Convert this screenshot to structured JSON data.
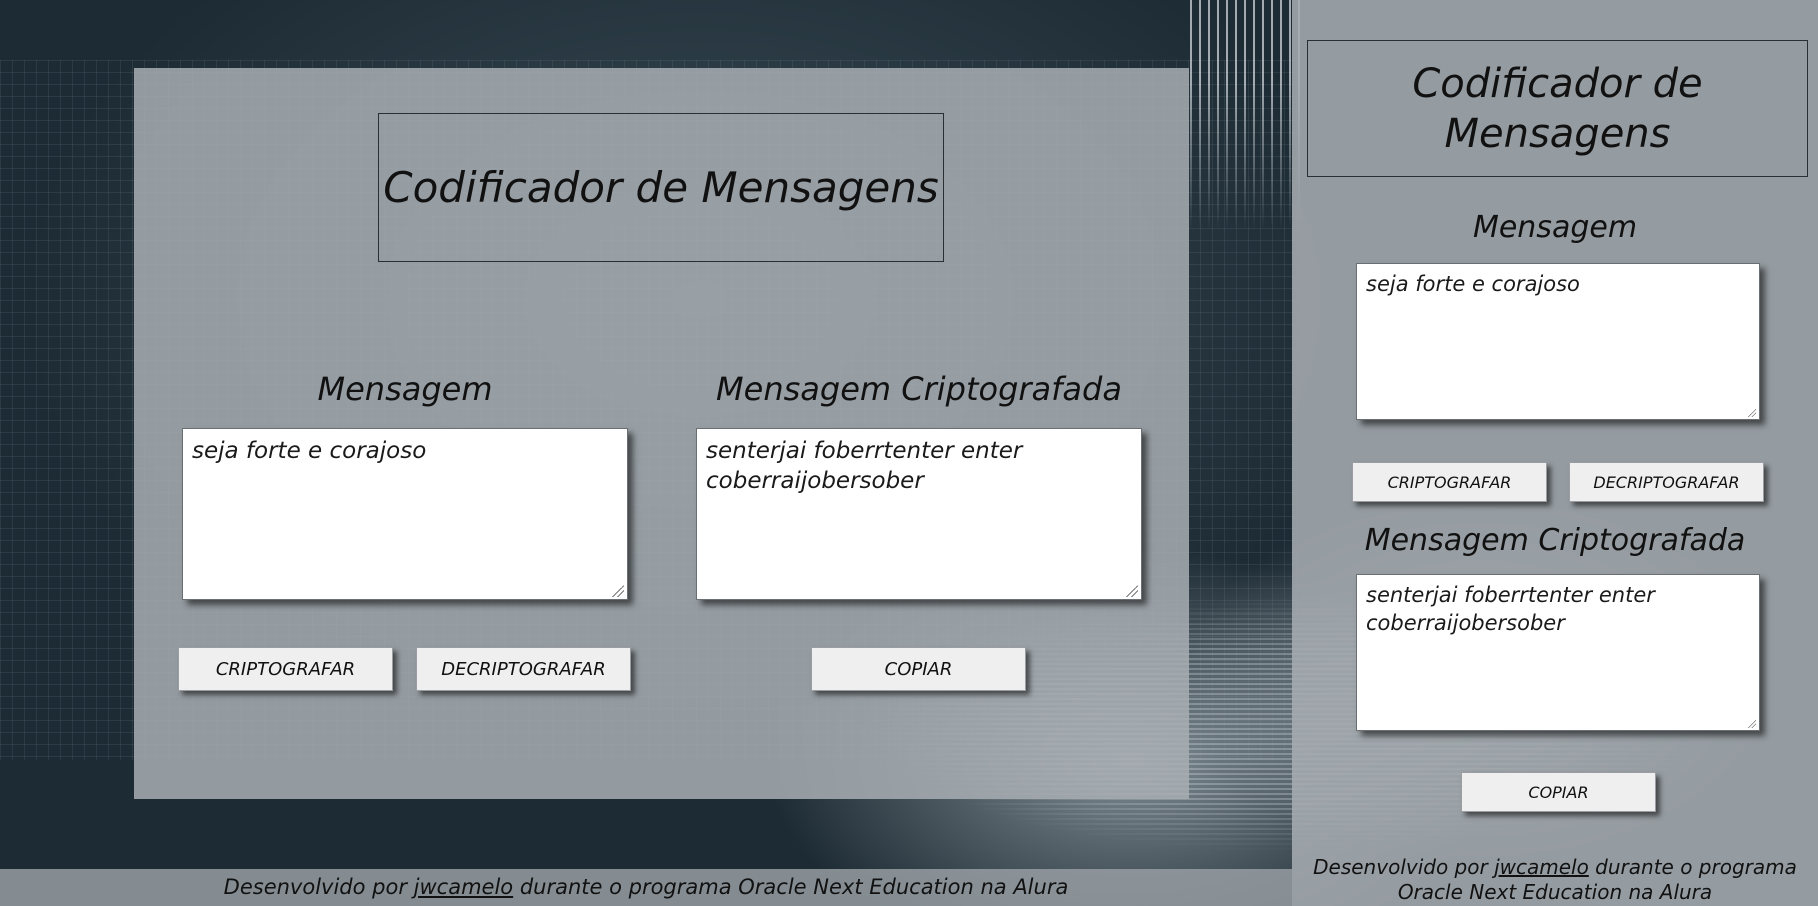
{
  "desktop": {
    "title": "Codificador de Mensagens",
    "message_label": "Mensagem",
    "encrypted_label": "Mensagem Criptografada",
    "message_value": "seja forte e corajoso",
    "encrypted_value": "senterjai foberrtenter enter coberraijobersober",
    "encrypt_button": "CRIPTOGRAFAR",
    "decrypt_button": "DECRIPTOGRAFAR",
    "copy_button": "COPIAR"
  },
  "mobile": {
    "title": "Codificador de Mensagens",
    "message_label": "Mensagem",
    "encrypted_label": "Mensagem Criptografada",
    "message_value": "seja forte e corajoso",
    "encrypted_value": "senterjai foberrtenter enter coberraijobersober",
    "encrypt_button": "CRIPTOGRAFAR",
    "decrypt_button": "DECRIPTOGRAFAR",
    "copy_button": "COPIAR"
  },
  "footer": {
    "prefix": "Desenvolvido por ",
    "author_link": "jwcamelo",
    "suffix": " durante o programa Oracle Next Education na Alura"
  }
}
